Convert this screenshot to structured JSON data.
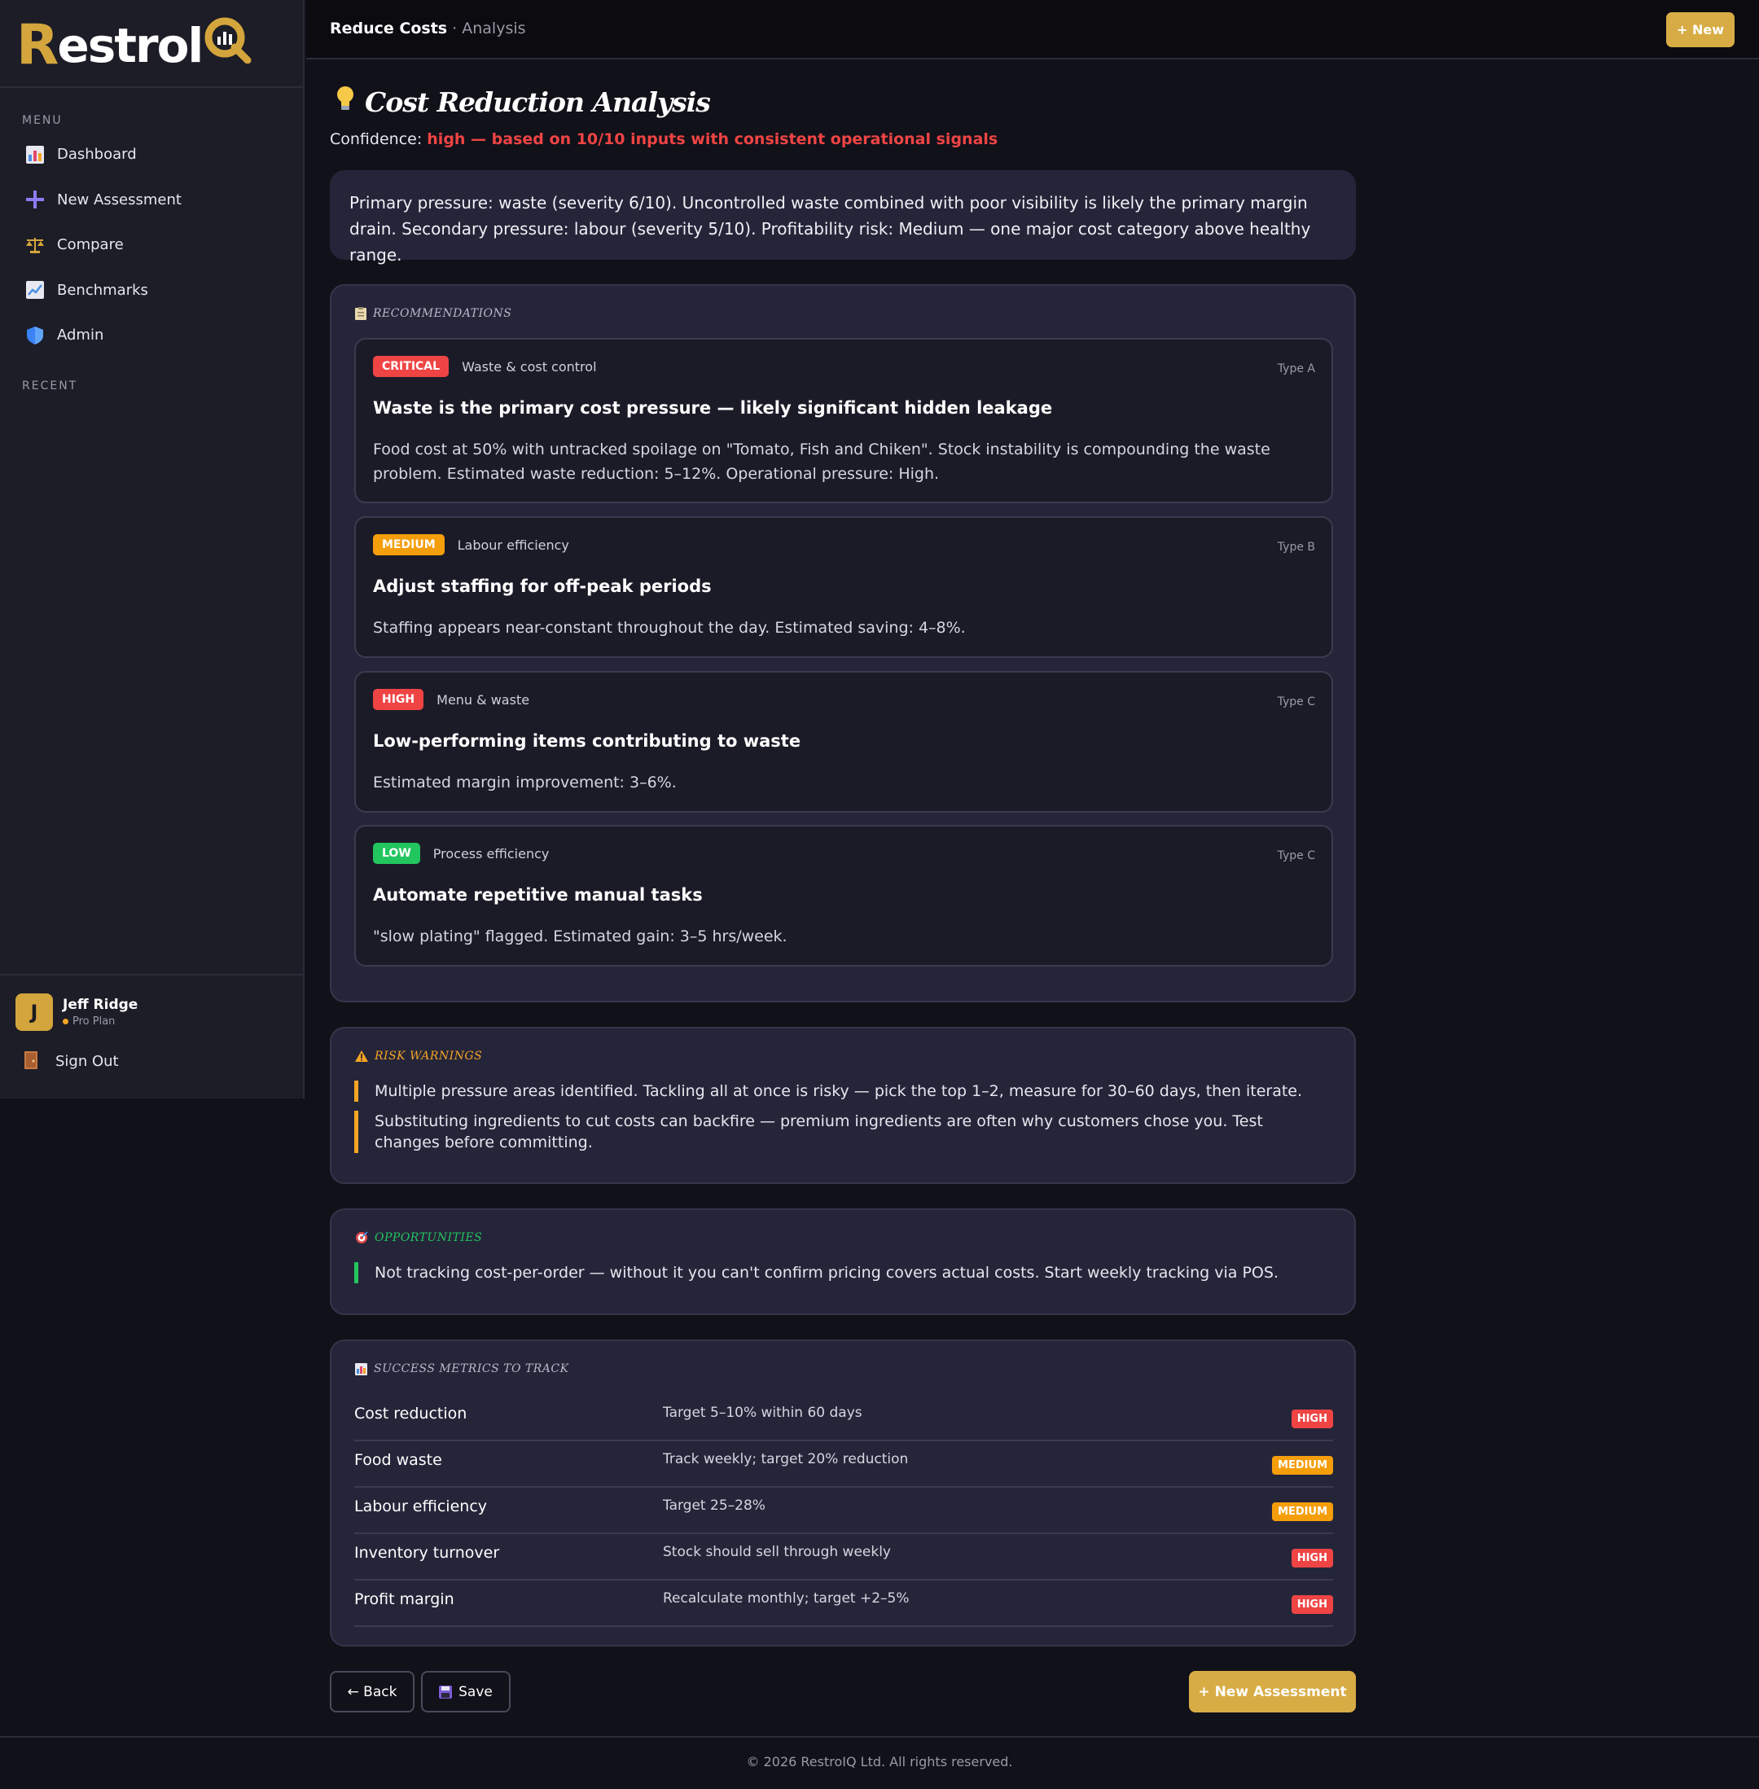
{
  "brand": {
    "logo_text_r": "R",
    "logo_text_main": "estrol",
    "logo_text_q": "Q"
  },
  "sidebar": {
    "menu_label": "MENU",
    "recent_label": "RECENT",
    "items": [
      {
        "label": "Dashboard",
        "icon": "bar-chart-icon"
      },
      {
        "label": "New Assessment",
        "icon": "plus-icon"
      },
      {
        "label": "Compare",
        "icon": "scales-icon"
      },
      {
        "label": "Benchmarks",
        "icon": "trend-chart-icon"
      },
      {
        "label": "Admin",
        "icon": "shield-icon"
      }
    ],
    "user": {
      "initial": "J",
      "name": "Jeff Ridge",
      "plan": "Pro Plan"
    },
    "signout_label": "Sign Out"
  },
  "topbar": {
    "crumb_main": "Reduce Costs",
    "crumb_sep": " · ",
    "crumb_sub": "Analysis",
    "new_button": "+ New"
  },
  "page": {
    "title": "Cost Reduction Analysis",
    "confidence_label": "Confidence: ",
    "confidence_value": "high — based on 10/10 inputs with consistent operational signals",
    "summary": "Primary pressure: waste (severity 6/10). Uncontrolled waste combined with poor visibility is likely the primary margin drain. Secondary pressure: labour (severity 5/10). Profitability risk: Medium — one major cost category above healthy range."
  },
  "recommendations": {
    "heading": "RECOMMENDATIONS",
    "items": [
      {
        "badge": "CRITICAL",
        "category": "Waste & cost control",
        "type": "Type A",
        "title": "Waste is the primary cost pressure — likely significant hidden leakage",
        "body": "Food cost at 50% with untracked spoilage on \"Tomato, Fish and Chiken\". Stock instability is compounding the waste problem. Estimated waste reduction: 5–12%. Operational pressure: High."
      },
      {
        "badge": "MEDIUM",
        "category": "Labour efficiency",
        "type": "Type B",
        "title": "Adjust staffing for off-peak periods",
        "body": "Staffing appears near-constant throughout the day. Estimated saving: 4–8%."
      },
      {
        "badge": "HIGH",
        "category": "Menu & waste",
        "type": "Type C",
        "title": "Low-performing items contributing to waste",
        "body": "Estimated margin improvement: 3–6%."
      },
      {
        "badge": "LOW",
        "category": "Process efficiency",
        "type": "Type C",
        "title": "Automate repetitive manual tasks",
        "body": "\"slow plating\" flagged. Estimated gain: 3–5 hrs/week."
      }
    ]
  },
  "risks": {
    "heading": "RISK WARNINGS",
    "items": [
      "Multiple pressure areas identified. Tackling all at once is risky — pick the top 1–2, measure for 30–60 days, then iterate.",
      "Substituting ingredients to cut costs can backfire — premium ingredients are often why customers chose you. Test changes before committing."
    ]
  },
  "opportunities": {
    "heading": "OPPORTUNITIES",
    "items": [
      "Not tracking cost-per-order — without it you can't confirm pricing covers actual costs. Start weekly tracking via POS."
    ]
  },
  "metrics": {
    "heading": "SUCCESS METRICS TO TRACK",
    "rows": [
      {
        "name": "Cost reduction",
        "target": "Target 5–10% within 60 days",
        "priority": "HIGH"
      },
      {
        "name": "Food waste",
        "target": "Track weekly; target 20% reduction",
        "priority": "MEDIUM"
      },
      {
        "name": "Labour efficiency",
        "target": "Target 25–28%",
        "priority": "MEDIUM"
      },
      {
        "name": "Inventory turnover",
        "target": "Stock should sell through weekly",
        "priority": "HIGH"
      },
      {
        "name": "Profit margin",
        "target": "Recalculate monthly; target +2–5%",
        "priority": "HIGH"
      }
    ]
  },
  "actions": {
    "back": "← Back",
    "save": "Save",
    "new_assessment": "+ New Assessment"
  },
  "footer": "© 2026 RestroIQ Ltd. All rights reserved.",
  "colors": {
    "gold": "#d8ac45",
    "critical": "#ef4444",
    "medium": "#f59e0b",
    "low": "#22c55e"
  }
}
